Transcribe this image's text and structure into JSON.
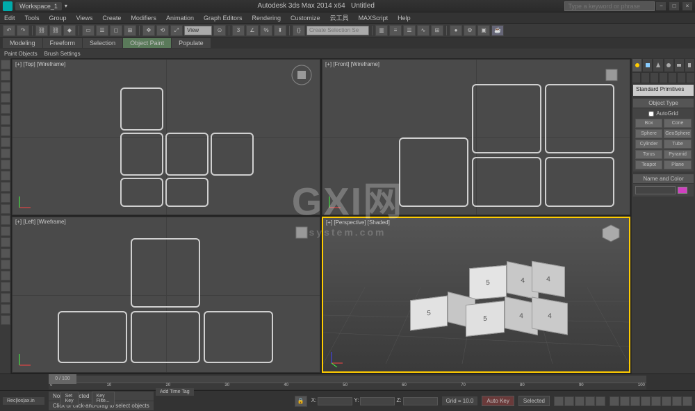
{
  "title": {
    "app": "Autodesk 3ds Max 2014 x64",
    "workspace": "Workspace_1",
    "file": "Untitled",
    "search_placeholder": "Type a keyword or phrase"
  },
  "menu": [
    "Edit",
    "Tools",
    "Group",
    "Views",
    "Create",
    "Modifiers",
    "Animation",
    "Graph Editors",
    "Rendering",
    "Customize",
    "云工具",
    "MAXScript",
    "Help"
  ],
  "toolbar1": {
    "view_label": "View",
    "selset_placeholder": "Create Selection Se"
  },
  "ribbon_tabs": [
    "Modeling",
    "Freeform",
    "Selection",
    "Object Paint",
    "Populate"
  ],
  "ribbon_active": "Object Paint",
  "ribbon_sub": [
    "Paint Objects",
    "Brush Settings"
  ],
  "viewports": {
    "top": {
      "label": "[+] [Top] [Wireframe]"
    },
    "front": {
      "label": "[+] [Front] [Wireframe]"
    },
    "left": {
      "label": "[+] [Left] [Wireframe]"
    },
    "persp": {
      "label": "[+] [Perspective] [Shaded]",
      "cube_labels": [
        "5",
        "4",
        "4",
        "5",
        "5",
        "4",
        "4"
      ]
    }
  },
  "cmdpanel": {
    "dropdown": "Standard Primitives",
    "rollout1": {
      "title": "Object Type",
      "autogrid": "AutoGrid",
      "buttons": [
        "Box",
        "Cone",
        "Sphere",
        "GeoSphere",
        "Cylinder",
        "Tube",
        "Torus",
        "Pyramid",
        "Teapot",
        "Plane"
      ]
    },
    "rollout2": {
      "title": "Name and Color"
    },
    "color": "#d040c0"
  },
  "timeline": {
    "current": "0 / 100",
    "ticks": [
      "0",
      "10",
      "20",
      "30",
      "40",
      "50",
      "60",
      "70",
      "80",
      "90",
      "100"
    ]
  },
  "status": {
    "selected": "None Selected",
    "prompt": "Click or click-and-drag to select objects",
    "coords": {
      "X": "",
      "Y": "",
      "Z": ""
    },
    "grid": "Grid = 10.0",
    "timetag": "Add Time Tag",
    "autokey": "Auto Key",
    "selbtn": "Selected",
    "setkey": "Set Key",
    "keyfilt": "Key Filte..."
  },
  "watermark": {
    "main": "GXI网",
    "sub": "system.com"
  }
}
